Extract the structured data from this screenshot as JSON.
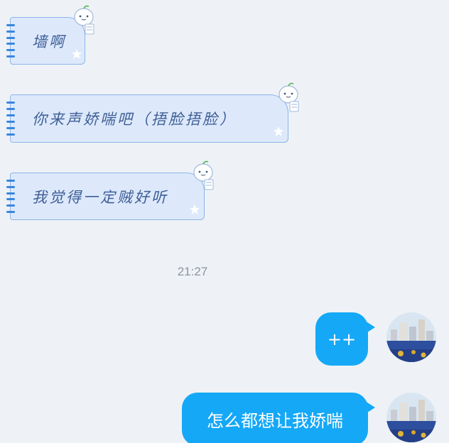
{
  "messages_in": [
    {
      "text": "墙啊"
    },
    {
      "text": "你来声娇喘吧（捂脸捂脸）"
    },
    {
      "text": "我觉得一定贼好听"
    }
  ],
  "timestamp": "21:27",
  "messages_out": [
    {
      "text": "++"
    },
    {
      "text": "怎么都想让我娇喘"
    }
  ],
  "colors": {
    "background": "#eef2f6",
    "incoming_bubble": "#dde9fb",
    "incoming_border": "#8db4ea",
    "incoming_text": "#3e5e96",
    "outgoing_bubble": "#15a8f7",
    "outgoing_text": "#ffffff",
    "timestamp_text": "#8e939a"
  },
  "icons": {
    "mascot": "cartoon-egg-mascot-icon",
    "star": "star-icon",
    "avatar": "city-skyline-avatar"
  }
}
